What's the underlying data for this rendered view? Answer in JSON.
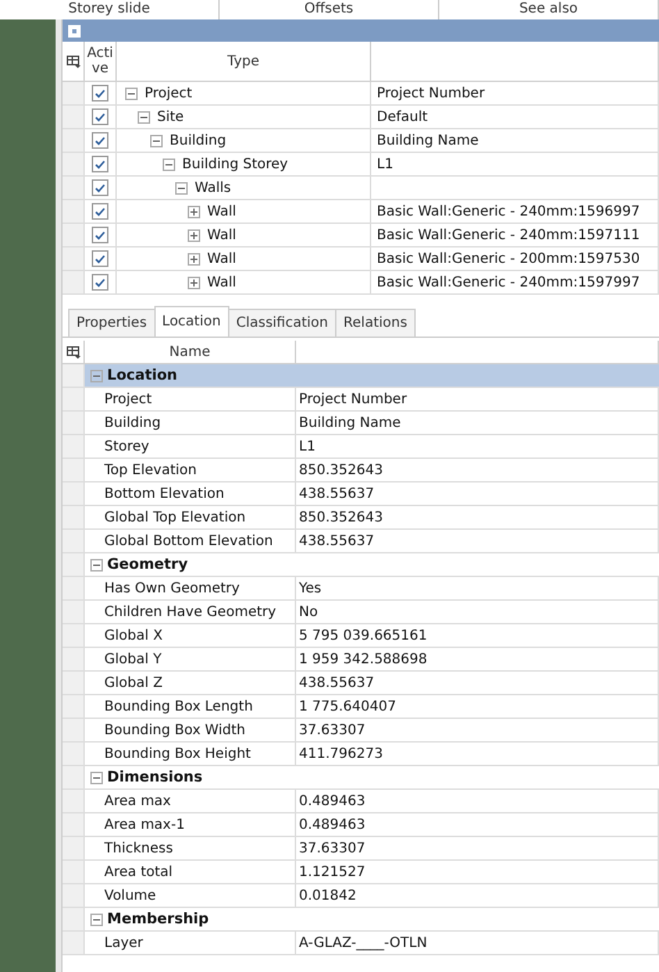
{
  "top_headers": [
    "Storey slide",
    "Offsets",
    "See also"
  ],
  "tree": {
    "columns": [
      "Active",
      "Type"
    ],
    "rows": [
      {
        "label": "Project",
        "value": "Project Number",
        "active": true,
        "expanded": true,
        "children": [
          {
            "label": "Site",
            "value": "Default",
            "active": true,
            "expanded": true,
            "children": [
              {
                "label": "Building",
                "value": "Building Name",
                "active": true,
                "expanded": true,
                "children": [
                  {
                    "label": "Building Storey",
                    "value": "L1",
                    "active": true,
                    "expanded": true,
                    "children": [
                      {
                        "label": "Walls",
                        "active": true,
                        "expanded": true,
                        "children": [
                          {
                            "label": "Wall",
                            "value": "Basic Wall:Generic - 240mm:1596997",
                            "active": true,
                            "expanded": false
                          },
                          {
                            "label": "Wall",
                            "value": "Basic Wall:Generic - 240mm:1597111",
                            "active": true,
                            "expanded": false
                          },
                          {
                            "label": "Wall",
                            "value": "Basic Wall:Generic - 200mm:1597530",
                            "active": true,
                            "expanded": false
                          },
                          {
                            "label": "Wall",
                            "value": "Basic Wall:Generic - 240mm:1597997",
                            "active": true,
                            "expanded": false
                          }
                        ]
                      }
                    ]
                  }
                ]
              }
            ]
          }
        ]
      }
    ]
  },
  "tabs": [
    {
      "label": "Properties",
      "selected": false
    },
    {
      "label": "Location",
      "selected": true
    },
    {
      "label": "Classification",
      "selected": false
    },
    {
      "label": "Relations",
      "selected": false
    }
  ],
  "properties": {
    "column": "Name",
    "groups": [
      {
        "title": "Location",
        "expanded": true,
        "selected": true,
        "items": [
          {
            "name": "Project",
            "value": "Project Number"
          },
          {
            "name": "Building",
            "value": "Building Name"
          },
          {
            "name": "Storey",
            "value": "L1"
          },
          {
            "name": "Top Elevation",
            "value": "850.352643"
          },
          {
            "name": "Bottom Elevation",
            "value": "438.55637"
          },
          {
            "name": "Global Top Elevation",
            "value": "850.352643"
          },
          {
            "name": "Global Bottom Elevation",
            "value": "438.55637"
          }
        ]
      },
      {
        "title": "Geometry",
        "expanded": true,
        "selected": false,
        "items": [
          {
            "name": "Has Own Geometry",
            "value": "Yes"
          },
          {
            "name": "Children Have Geometry",
            "value": "No"
          },
          {
            "name": "Global X",
            "value": "5 795 039.665161"
          },
          {
            "name": "Global Y",
            "value": "1 959 342.588698"
          },
          {
            "name": "Global Z",
            "value": "438.55637"
          },
          {
            "name": "Bounding Box Length",
            "value": "1 775.640407"
          },
          {
            "name": "Bounding Box Width",
            "value": "37.63307"
          },
          {
            "name": "Bounding Box Height",
            "value": "411.796273"
          }
        ]
      },
      {
        "title": "Dimensions",
        "expanded": true,
        "selected": false,
        "items": [
          {
            "name": "Area max",
            "value": "0.489463"
          },
          {
            "name": "Area max-1",
            "value": "0.489463"
          },
          {
            "name": "Thickness",
            "value": "37.63307"
          },
          {
            "name": "Area total",
            "value": "1.121527"
          },
          {
            "name": "Volume",
            "value": "0.01842"
          }
        ]
      },
      {
        "title": "Membership",
        "expanded": true,
        "selected": false,
        "items": [
          {
            "name": "Layer",
            "value": "A-GLAZ-____-OTLN"
          }
        ]
      }
    ]
  }
}
